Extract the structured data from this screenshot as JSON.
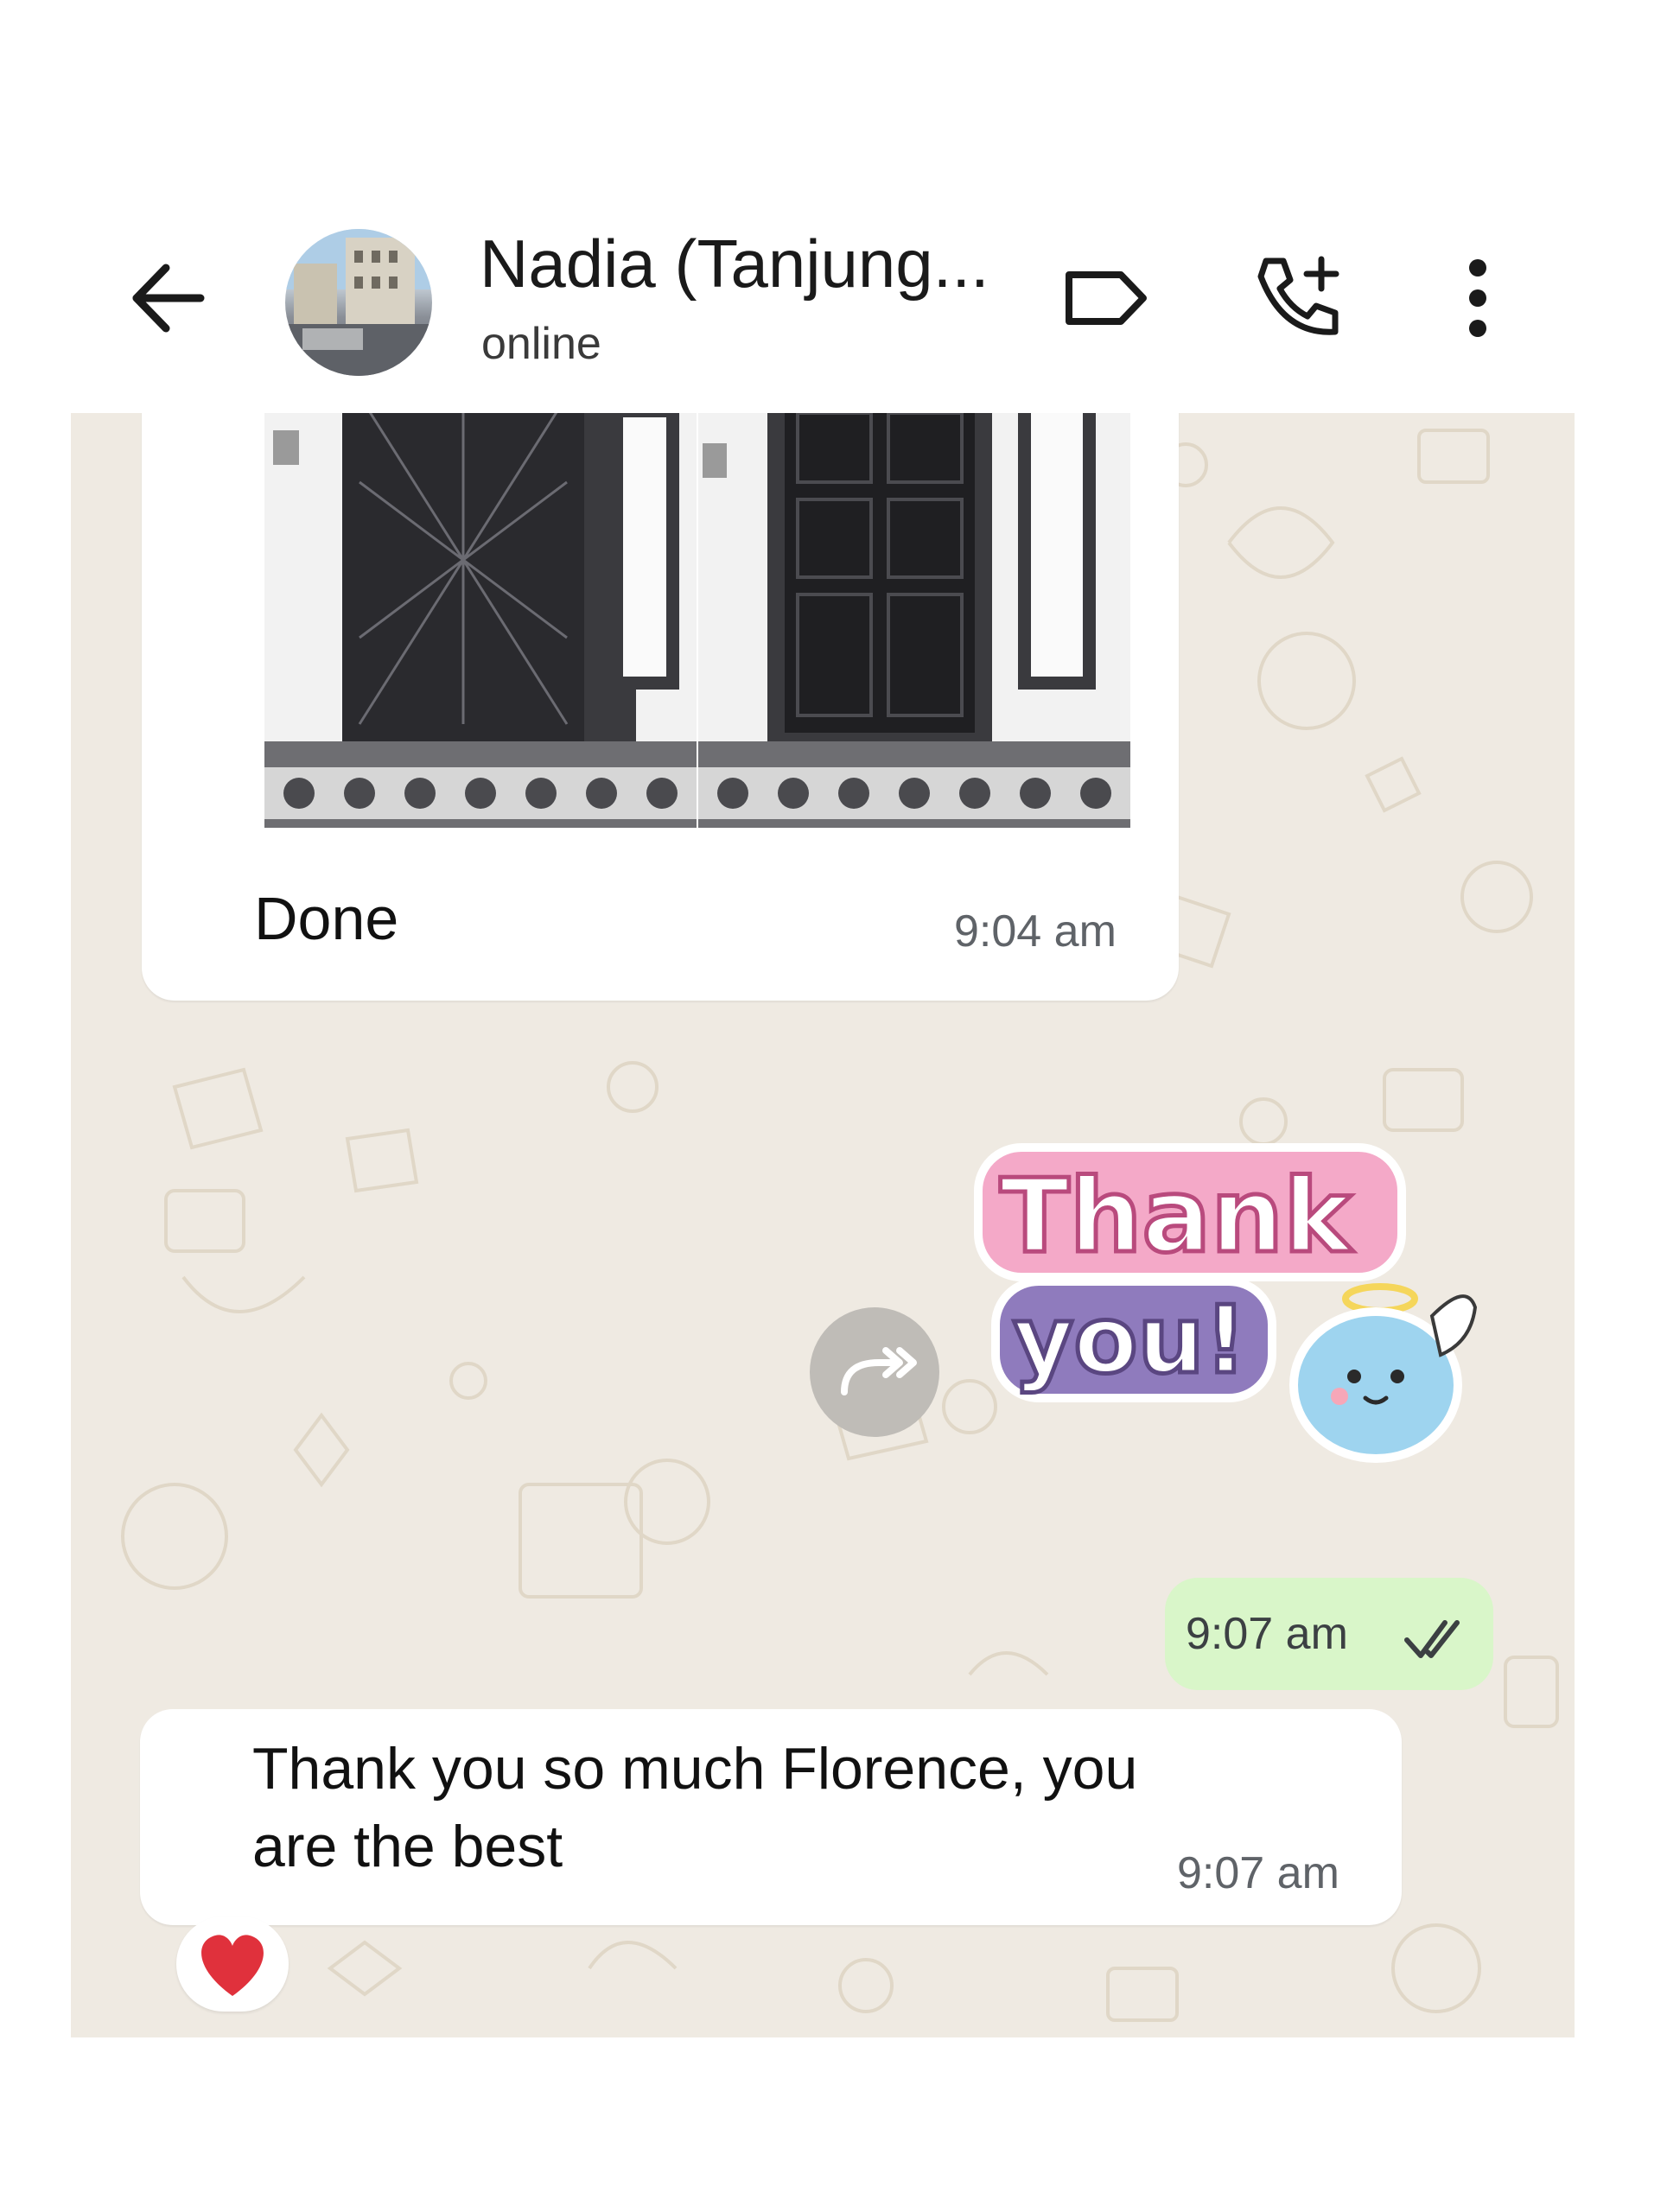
{
  "header": {
    "contact_name": "Nadia (Tanjung...",
    "status": "online",
    "icons": {
      "back": "arrow-back-icon",
      "label": "label-icon",
      "call": "add-call-icon",
      "menu": "more-vert-icon"
    }
  },
  "messages": [
    {
      "direction": "incoming",
      "type": "photos",
      "caption": "Done",
      "time": "9:04 am"
    },
    {
      "direction": "outgoing",
      "type": "sticker",
      "sticker_text_line1": "Thank",
      "sticker_text_line2": "you!",
      "time": "9:07 am",
      "read_icon": "double-check-icon"
    },
    {
      "direction": "incoming",
      "type": "text",
      "line1": "Thank you so much Florence, you",
      "line2": "are the best",
      "time": "9:07 am",
      "reaction": "❤️"
    }
  ],
  "colors": {
    "chat_background": "#efeae2",
    "incoming_bubble": "#ffffff",
    "outgoing_bubble": "#d9f6c9",
    "sticker_pink": "#f4a9c8",
    "sticker_purple": "#8f7bbd",
    "sticker_blue": "#9ed4ef"
  }
}
